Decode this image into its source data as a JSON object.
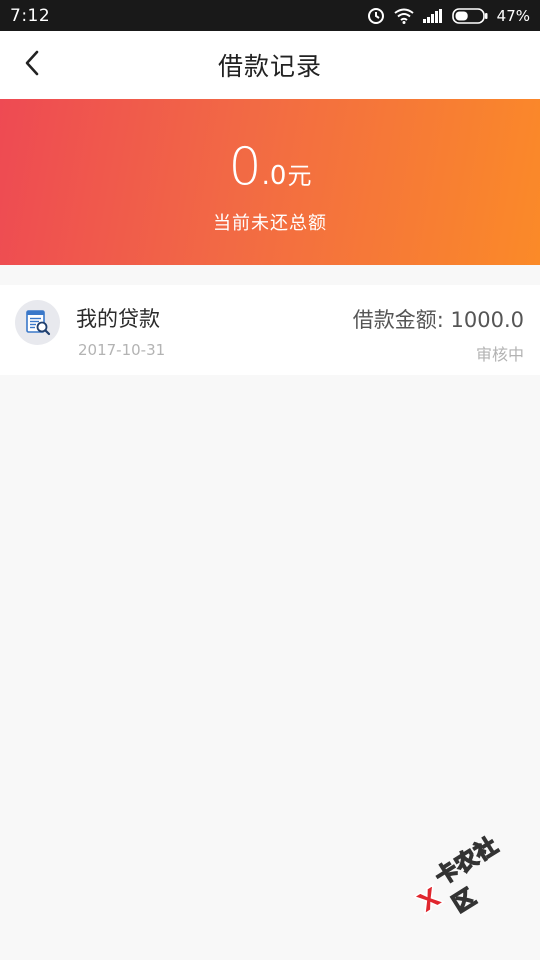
{
  "status_bar": {
    "time": "7:12",
    "battery_percent": "47%",
    "battery_level": 0.47,
    "icons": [
      "alarm-icon",
      "wifi-icon",
      "signal-icon",
      "battery-icon"
    ]
  },
  "nav": {
    "title": "借款记录",
    "back_icon": "chevron-left-icon"
  },
  "banner": {
    "amount_int": "0",
    "amount_dec": ".0",
    "unit": "元",
    "label": "当前未还总额",
    "gradient_start": "#ee4a53",
    "gradient_end": "#fb8a28"
  },
  "loans": [
    {
      "name": "我的贷款",
      "date": "2017-10-31",
      "amount_label": "借款金额: ",
      "amount": "1000.0",
      "status": "审核中",
      "icon": "document-search-icon"
    }
  ],
  "watermark": {
    "text": "卡农社区"
  },
  "colors": {
    "background": "#f8f8f8",
    "status_bar": "#191919",
    "icon_blue": "#3a78c9"
  }
}
